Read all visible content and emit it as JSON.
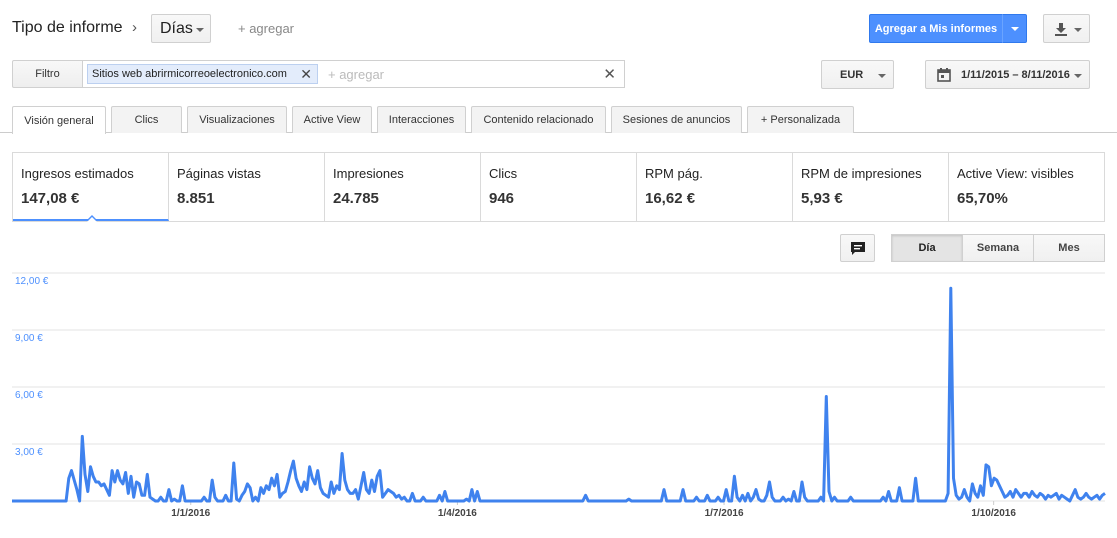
{
  "header": {
    "title": "Tipo de informe",
    "chevron": "›",
    "days_select": "Días",
    "add_link": "+ agregar",
    "add_to_reports": "Agregar a Mis informes"
  },
  "filter": {
    "button_label": "Filtro",
    "chip_prefix": "Sitios web",
    "chip_value": "abrirmicorreoelectronico.com",
    "chip_close": "✕",
    "add_placeholder": "+ agregar",
    "clear": "✕"
  },
  "currency": {
    "selected": "EUR"
  },
  "date_range": {
    "label": "1/11/2015 – 8/11/2016"
  },
  "tabs": [
    {
      "label": "Visión general",
      "active": true
    },
    {
      "label": "Clics"
    },
    {
      "label": "Visualizaciones"
    },
    {
      "label": "Active View"
    },
    {
      "label": "Interacciones"
    },
    {
      "label": "Contenido relacionado"
    },
    {
      "label": "Sesiones de anuncios"
    },
    {
      "label": "+  Personalizada"
    }
  ],
  "metrics": [
    {
      "label": "Ingresos estimados",
      "value": "147,08 €",
      "active": true
    },
    {
      "label": "Páginas vistas",
      "value": "8.851"
    },
    {
      "label": "Impresiones",
      "value": "24.785"
    },
    {
      "label": "Clics",
      "value": "946"
    },
    {
      "label": "RPM pág.",
      "value": "16,62 €"
    },
    {
      "label": "RPM de impresiones",
      "value": "5,93 €"
    },
    {
      "label": "Active View: visibles",
      "value": "65,70%"
    }
  ],
  "granularity": [
    {
      "label": "Día",
      "active": true
    },
    {
      "label": "Semana"
    },
    {
      "label": "Mes"
    }
  ],
  "colors": {
    "accent": "#4d90fe",
    "line": "#3f82ee",
    "grid": "#e3e3e3"
  },
  "icons": {
    "download": "download-icon",
    "calendar": "calendar-icon",
    "annotate": "comment-icon"
  },
  "chart_data": {
    "type": "line",
    "x_start": "2015-11-01",
    "x_end": "2016-11-08",
    "x_ticks": [
      "1/1/2016",
      "1/4/2016",
      "1/7/2016",
      "1/10/2016"
    ],
    "y_ticks": [
      "3,00 €",
      "6,00 €",
      "9,00 €",
      "12,00 €"
    ],
    "ylim": [
      0,
      12
    ],
    "series": [
      {
        "values": [
          0,
          0,
          0,
          0,
          0,
          0,
          0,
          0,
          0,
          0,
          0,
          0,
          0,
          0,
          0,
          0,
          0,
          0,
          0,
          0,
          0,
          1.2,
          1.6,
          1.1,
          0.6,
          0,
          3.4,
          1.4,
          0.5,
          1.8,
          1.3,
          1.0,
          1.0,
          0.8,
          0.9,
          0.6,
          0.3,
          1.6,
          1.0,
          1.6,
          1.1,
          0.9,
          1.5,
          0.4,
          1.3,
          0.2,
          1.0,
          0.9,
          0.3,
          0.3,
          1.4,
          0.2,
          0.1,
          0,
          0,
          0.2,
          0,
          0,
          0.6,
          0,
          0.1,
          0,
          0,
          0.8,
          0,
          0,
          0,
          0,
          0,
          0,
          0,
          0.2,
          0,
          0,
          1.1,
          0.2,
          0,
          0,
          0,
          0.3,
          0,
          0,
          2.0,
          0.1,
          0,
          0.3,
          0.5,
          0.9,
          0.7,
          0,
          0.2,
          0,
          0.7,
          0.4,
          0.8,
          0.6,
          1.2,
          0.8,
          1.4,
          0.2,
          0.4,
          0.5,
          1.0,
          1.6,
          2.1,
          1.2,
          0.8,
          0.5,
          1.0,
          0.6,
          1.8,
          1.2,
          0.9,
          1.6,
          0.7,
          0.4,
          0.3,
          0.2,
          1.0,
          0.4,
          0.8,
          0.6,
          2.5,
          1.1,
          0.6,
          0.4,
          0.4,
          0.6,
          0.1,
          0.8,
          1.5,
          0.6,
          0.4,
          1.1,
          0.5,
          1.3,
          1.6,
          0.2,
          0.4,
          0.6,
          0.5,
          0.4,
          0.2,
          0.3,
          0.1,
          0.2,
          0,
          0,
          0.4,
          0,
          0,
          0,
          0.2,
          0,
          0,
          0,
          0,
          0,
          0.3,
          0,
          0.5,
          0,
          0,
          0,
          0,
          0,
          0,
          0,
          0.1,
          0,
          0.6,
          0,
          0.5,
          0,
          0,
          0,
          0,
          0,
          0,
          0,
          0,
          0,
          0,
          0,
          0,
          0,
          0,
          0,
          0,
          0,
          0,
          0,
          0,
          0,
          0,
          0,
          0,
          0,
          0,
          0,
          0,
          0,
          0,
          0,
          0,
          0,
          0,
          0,
          0,
          0,
          0,
          0,
          0.3,
          0,
          0,
          0,
          0,
          0,
          0,
          0,
          0,
          0,
          0,
          0,
          0,
          0,
          0,
          0,
          0.1,
          0,
          0,
          0,
          0,
          0,
          0,
          0,
          0,
          0,
          0,
          0,
          0,
          0.6,
          0,
          0,
          0,
          0,
          0,
          0,
          0.6,
          0,
          0,
          0,
          0,
          0.2,
          0,
          0,
          0,
          0.3,
          0,
          0,
          0,
          0.2,
          0,
          0,
          0.6,
          0,
          0,
          1.3,
          0.2,
          0,
          0.3,
          0,
          0.4,
          0,
          0.2,
          0.6,
          0.1,
          0,
          0,
          0.3,
          1.0,
          0.2,
          0,
          0,
          0,
          0.2,
          0,
          0.1,
          0,
          0.5,
          0,
          0,
          1.0,
          0.2,
          0,
          0,
          0,
          0,
          0,
          0.2,
          0,
          5.5,
          0.5,
          0,
          0.2,
          0,
          0,
          0,
          0,
          0,
          0.2,
          0,
          0,
          0,
          0,
          0,
          0,
          0,
          0,
          0,
          0,
          0,
          0.2,
          0,
          0.5,
          0,
          0,
          0,
          0.7,
          0,
          0,
          0,
          0,
          0,
          1.2,
          0,
          0,
          0,
          0,
          0,
          0,
          0,
          0,
          0,
          0,
          0,
          0.4,
          11.2,
          1.2,
          0.3,
          0.1,
          0.2,
          0.6,
          0.2,
          0,
          0.9,
          0.4,
          0.2,
          0.8,
          0.3,
          1.9,
          1.8,
          0.8,
          1.2,
          1.1,
          0.8,
          0.5,
          0.2,
          0.3,
          0.5,
          0.2,
          0.6,
          0.4,
          0.2,
          0.4,
          0.4,
          0.2,
          0.5,
          0.3,
          0.2,
          0.4,
          0.3,
          0.1,
          0.3,
          0.2,
          0.3,
          0.4,
          0.1,
          0.3,
          0.2,
          0.1,
          0,
          0.3,
          0.6,
          0.2,
          0.1,
          0.2,
          0.4,
          0.2,
          0.1,
          0.2,
          0.3,
          0.1,
          0.3,
          0.4
        ]
      }
    ]
  }
}
